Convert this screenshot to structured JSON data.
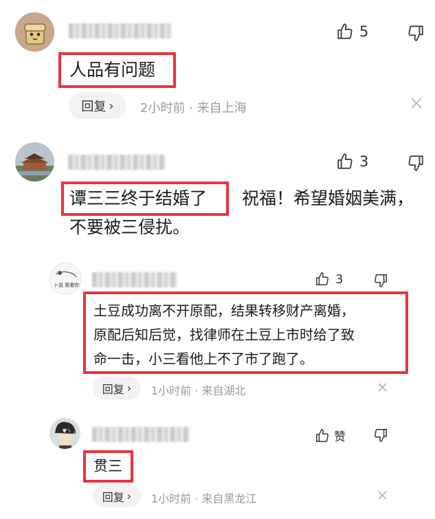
{
  "comments": [
    {
      "like_count": "5",
      "text": "人品有问题",
      "reply_label": "回复",
      "meta": "2小时前 · 来自上海"
    },
    {
      "like_count": "3",
      "text_highlight": "谭三三终于结婚了",
      "text_rest": "祝福！希望婚姻美满，",
      "text_line2": "不要被三侵扰。",
      "replies": [
        {
          "like_count": "3",
          "text_lines": [
            "土豆成功离不开原配，结果转移财产离婚，",
            "原配后知后觉，找律师在土豆上市时给了致",
            "命一击，小三看他上不了市了跑了。"
          ],
          "reply_label": "回复",
          "meta": "1小时前 · 来自湖北"
        },
        {
          "like_label": "赞",
          "text": "贯三",
          "reply_label": "回复",
          "meta": "1小时前 · 来自黑龙江"
        }
      ]
    }
  ],
  "icons": {
    "like": "thumbs-up-icon",
    "dislike": "thumbs-down-icon",
    "close": "close-icon",
    "chevron": "chevron-right-icon"
  },
  "colors": {
    "highlight_border": "#e8343f",
    "meta_text": "#9a9a9a",
    "reply_bg": "#f2f2f2"
  }
}
